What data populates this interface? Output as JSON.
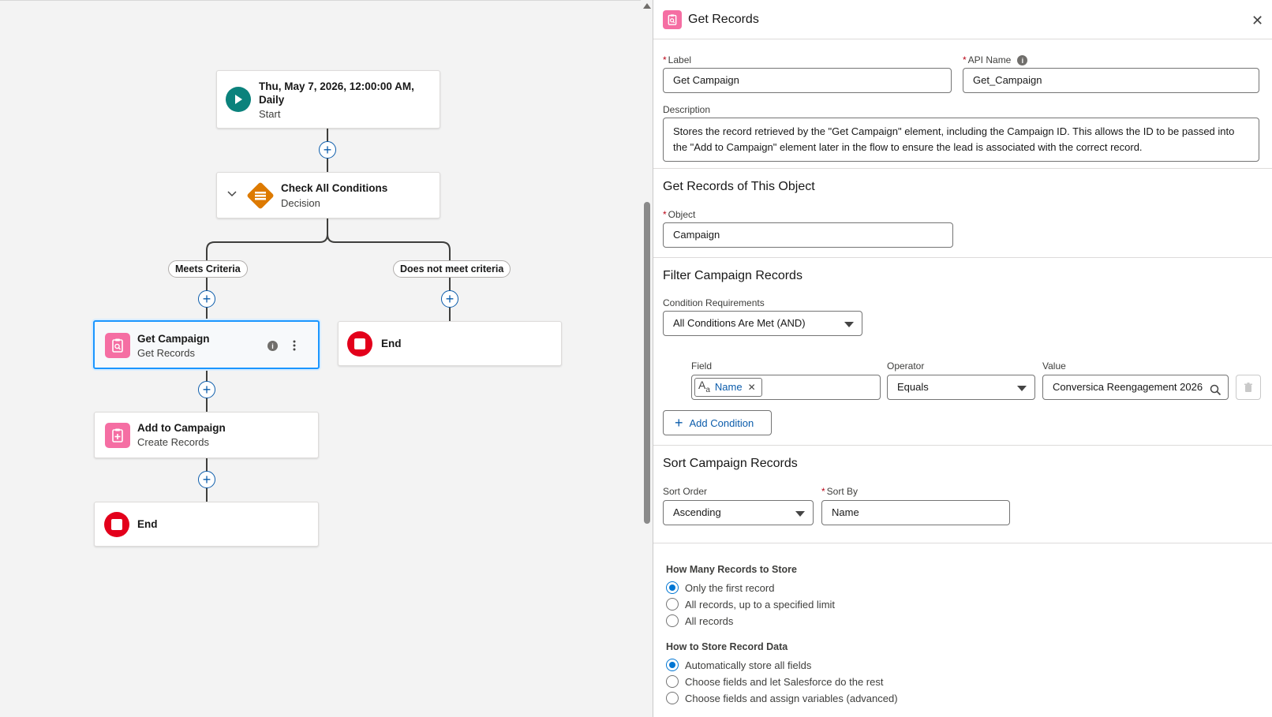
{
  "canvas": {
    "start": {
      "title_line1": "Thu, May 7, 2026, 12:00:00 AM,",
      "title_line2": "Daily",
      "subtitle": "Start"
    },
    "decision": {
      "title": "Check All Conditions",
      "subtitle": "Decision"
    },
    "branches": {
      "left": "Meets Criteria",
      "right": "Does not meet criteria"
    },
    "get_campaign": {
      "title": "Get Campaign",
      "subtitle": "Get Records"
    },
    "add_to_campaign": {
      "title": "Add to Campaign",
      "subtitle": "Create Records"
    },
    "end_label": "End",
    "colors": {
      "connector": "#3e3e3c",
      "plus": "#0b5cab",
      "selected_border": "#1b96ff",
      "start": "#0b827c",
      "decision": "#dd7a01",
      "records": "#f56ea3",
      "end": "#e3001b"
    }
  },
  "panel": {
    "title": "Get Records",
    "label": {
      "label": "Label",
      "value": "Get Campaign"
    },
    "api_name": {
      "label": "API Name",
      "value": "Get_Campaign"
    },
    "description": {
      "label": "Description",
      "value": "Stores the record retrieved by the \"Get Campaign\" element, including the Campaign ID. This allows the ID to be passed into the \"Add to Campaign\" element later in the flow to ensure the lead is associated with the correct record."
    },
    "object_section": {
      "title": "Get Records of This Object",
      "object_label": "Object",
      "object_value": "Campaign"
    },
    "filter_section": {
      "title": "Filter Campaign Records",
      "condition_req_label": "Condition Requirements",
      "condition_req_value": "All Conditions Are Met (AND)",
      "field_label": "Field",
      "field_value": "Name",
      "operator_label": "Operator",
      "operator_value": "Equals",
      "value_label": "Value",
      "value_value": "Conversica Reengagement 2026",
      "add_condition": "Add Condition"
    },
    "sort_section": {
      "title": "Sort Campaign Records",
      "sort_order_label": "Sort Order",
      "sort_order_value": "Ascending",
      "sort_by_label": "Sort By",
      "sort_by_value": "Name"
    },
    "how_many": {
      "title": "How Many Records to Store",
      "options": [
        "Only the first record",
        "All records, up to a specified limit",
        "All records"
      ],
      "selected": 0
    },
    "how_store": {
      "title": "How to Store Record Data",
      "options": [
        "Automatically store all fields",
        "Choose fields and let Salesforce do the rest",
        "Choose fields and assign variables (advanced)"
      ],
      "selected": 0
    },
    "colors": {
      "accent": "#0176d3",
      "required": "#ba0517"
    }
  }
}
